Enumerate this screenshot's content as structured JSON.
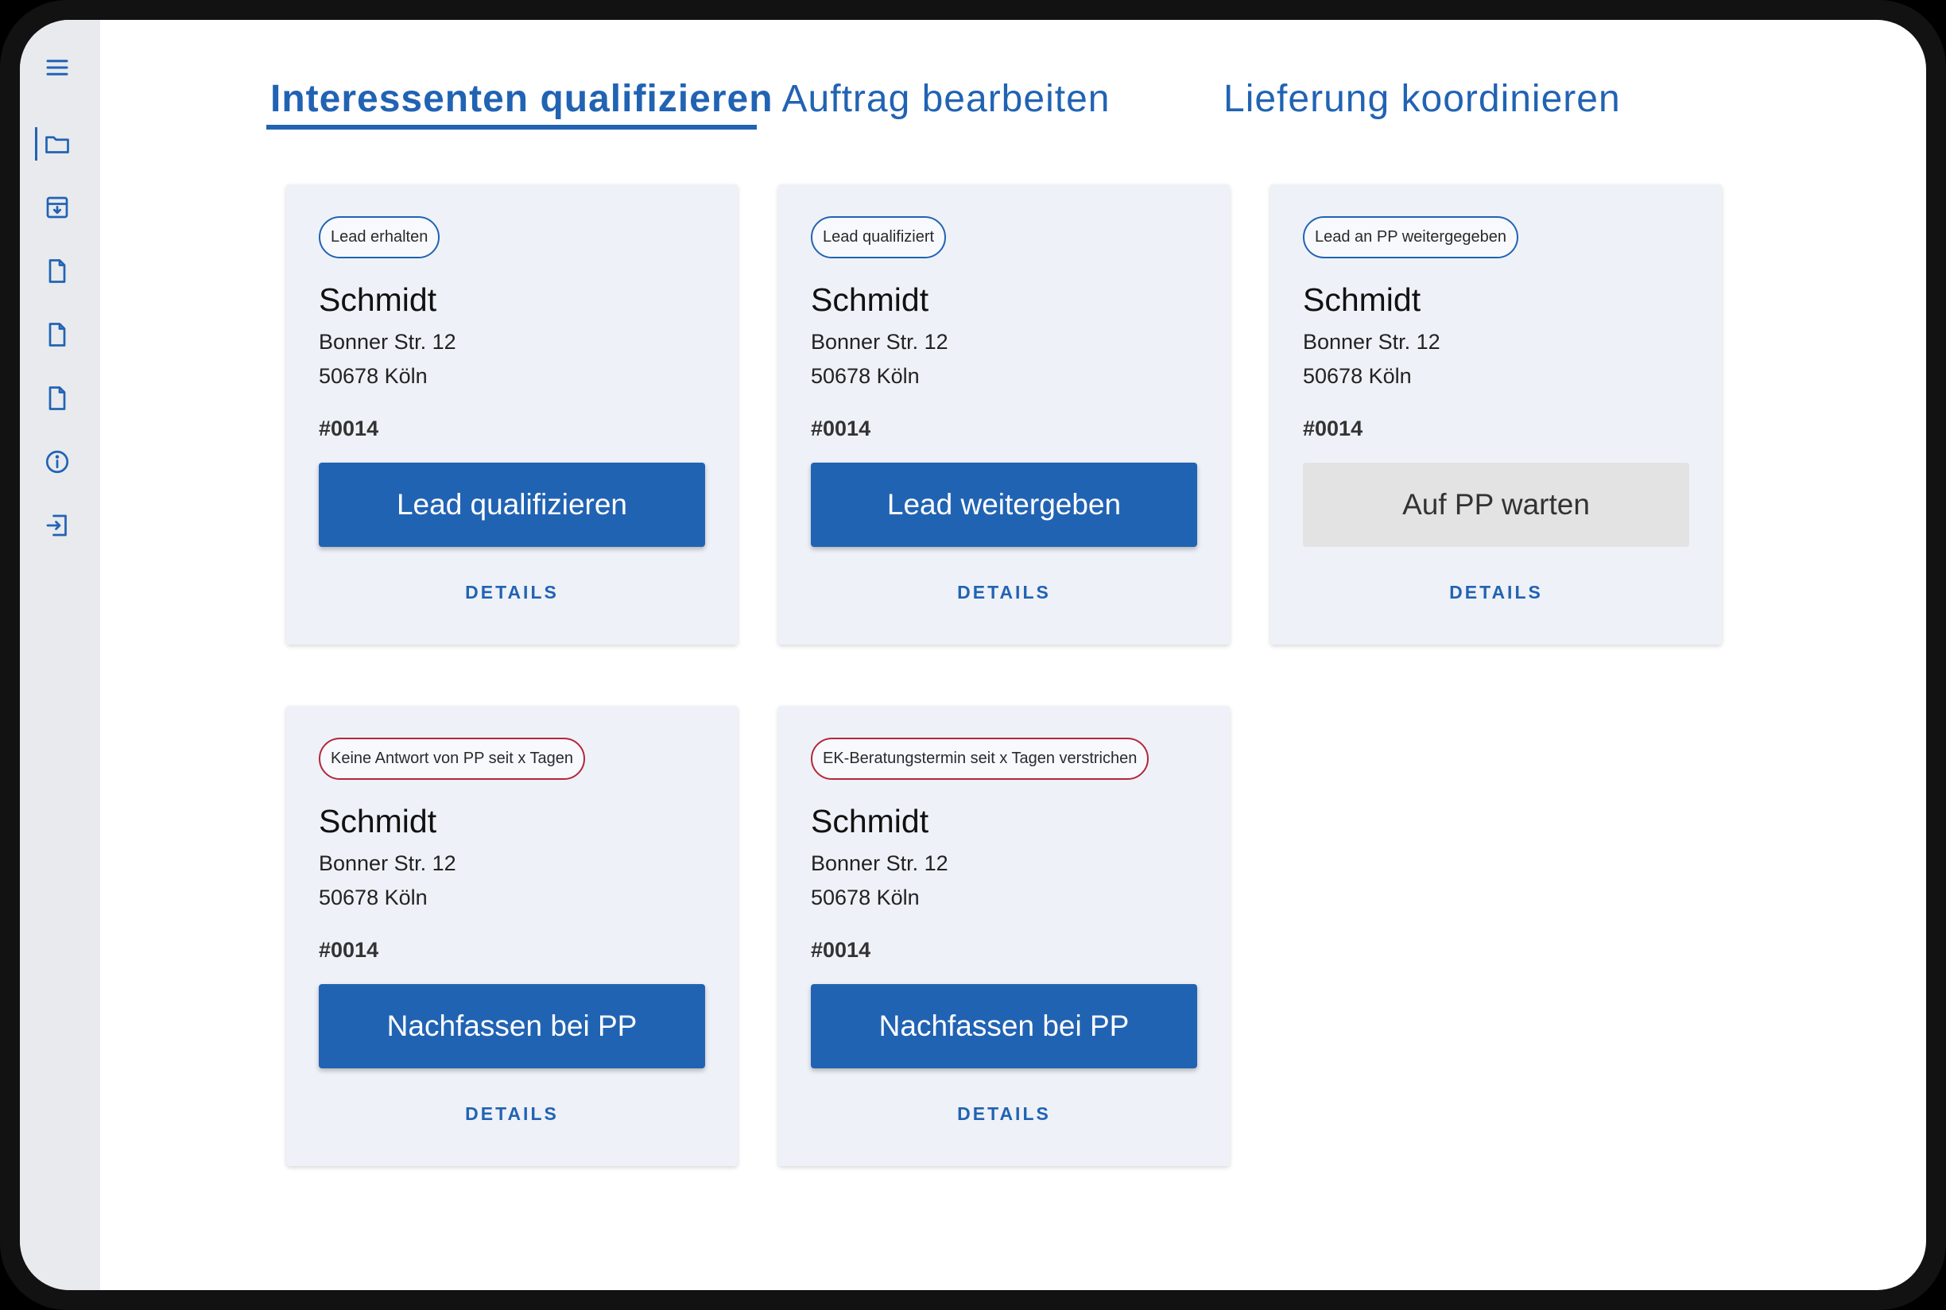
{
  "sidebar": {
    "items": [
      {
        "icon": "menu-icon"
      },
      {
        "icon": "folder-icon",
        "active": true
      },
      {
        "icon": "archive-download-icon"
      },
      {
        "icon": "document-icon"
      },
      {
        "icon": "document-icon"
      },
      {
        "icon": "document-icon"
      },
      {
        "icon": "info-icon"
      },
      {
        "icon": "logout-icon"
      }
    ]
  },
  "tabs": [
    {
      "label": "Interessenten qualifizieren",
      "active": true
    },
    {
      "label": "Auftrag bearbeiten",
      "active": false
    },
    {
      "label": "Lieferung koordinieren",
      "active": false
    }
  ],
  "cards": [
    {
      "badge": "Lead erhalten",
      "badge_type": "info",
      "name": "Schmidt",
      "street": "Bonner Str. 12",
      "city": "50678 Köln",
      "number": "#0014",
      "action": "Lead qualifizieren",
      "action_enabled": true,
      "details": "DETAILS"
    },
    {
      "badge": "Lead qualifiziert",
      "badge_type": "info",
      "name": "Schmidt",
      "street": "Bonner Str. 12",
      "city": "50678 Köln",
      "number": "#0014",
      "action": "Lead weitergeben",
      "action_enabled": true,
      "details": "DETAILS"
    },
    {
      "badge": "Lead an PP weitergegeben",
      "badge_type": "info",
      "name": "Schmidt",
      "street": "Bonner Str. 12",
      "city": "50678 Köln",
      "number": "#0014",
      "action": "Auf PP warten",
      "action_enabled": false,
      "details": "DETAILS"
    },
    {
      "badge": "Keine Antwort von PP seit x Tagen",
      "badge_type": "warning",
      "name": "Schmidt",
      "street": "Bonner Str. 12",
      "city": "50678 Köln",
      "number": "#0014",
      "action": "Nachfassen bei PP",
      "action_enabled": true,
      "details": "DETAILS"
    },
    {
      "badge": "EK-Beratungstermin seit x Tagen verstrichen",
      "badge_type": "warning",
      "name": "Schmidt",
      "street": "Bonner Str. 12",
      "city": "50678 Köln",
      "number": "#0014",
      "action": "Nachfassen bei PP",
      "action_enabled": true,
      "details": "DETAILS"
    }
  ],
  "colors": {
    "primary": "#2163b3",
    "warning": "#b3263a",
    "card_bg": "#eef1f7",
    "sidebar_bg": "#e8eaee"
  }
}
